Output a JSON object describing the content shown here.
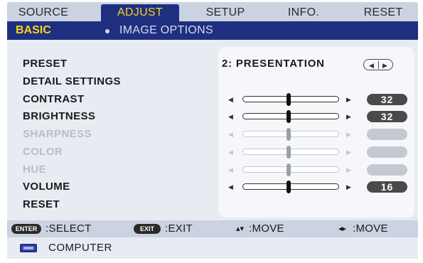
{
  "tabs": [
    {
      "label": "SOURCE",
      "active": false
    },
    {
      "label": "ADJUST",
      "active": true
    },
    {
      "label": "SETUP",
      "active": false
    },
    {
      "label": "INFO.",
      "active": false
    },
    {
      "label": "RESET",
      "active": false
    }
  ],
  "subtabs": {
    "active": "BASIC",
    "other": "IMAGE OPTIONS"
  },
  "settings": {
    "preset": {
      "label": "PRESET",
      "value": "2:  PRESENTATION"
    },
    "detail": {
      "label": "DETAIL SETTINGS"
    },
    "contrast": {
      "label": "CONTRAST",
      "value": "32",
      "enabled": true
    },
    "brightness": {
      "label": "BRIGHTNESS",
      "value": "32",
      "enabled": true
    },
    "sharpness": {
      "label": "SHARPNESS",
      "value": "",
      "enabled": false
    },
    "color": {
      "label": "COLOR",
      "value": "",
      "enabled": false
    },
    "hue": {
      "label": "HUE",
      "value": "",
      "enabled": false
    },
    "volume": {
      "label": "VOLUME",
      "value": "16",
      "enabled": true
    },
    "reset": {
      "label": "RESET"
    }
  },
  "help": {
    "enter_key": "ENTER",
    "select_text": ":SELECT",
    "exit_key": "EXIT",
    "exit_text": ":EXIT",
    "move_vertical_text": ":MOVE",
    "move_horizontal_text": ":MOVE"
  },
  "source": {
    "icon": "computer-input-icon",
    "label": "COMPUTER"
  },
  "colors": {
    "accent_navy": "#1f2f80",
    "accent_yellow": "#f7d51d",
    "tab_bar": "#cbd3e2",
    "panel_bg": "#e8ebf2"
  }
}
